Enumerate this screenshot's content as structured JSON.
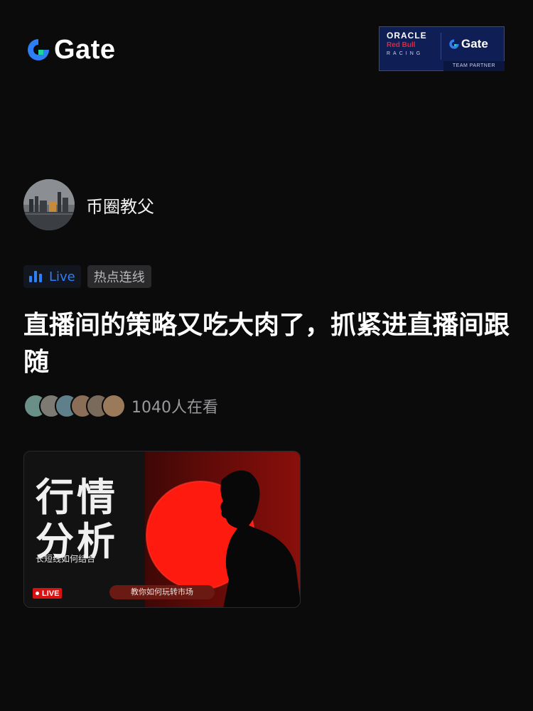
{
  "brand": {
    "logo_text": "Gate",
    "accent": "#2d7ef7"
  },
  "partner_badge": {
    "line1": "ORACLE",
    "line2": "Red Bull",
    "line3": "RACING",
    "brand": "Gate",
    "caption": "TEAM PARTNER"
  },
  "post": {
    "author": "币圈教父",
    "tags": [
      {
        "label": "Live",
        "icon": "bar-chart-icon"
      },
      {
        "label": "热点连线"
      }
    ],
    "title": "直播间的策略又吃大肉了，抓紧进直播间跟随",
    "viewer_text": "1040人在看"
  },
  "card": {
    "headline_1": "行情",
    "headline_2": "分析",
    "subtitle": "长短线如何结合",
    "badge": "LIVE",
    "pill": "教你如何玩转市场"
  }
}
